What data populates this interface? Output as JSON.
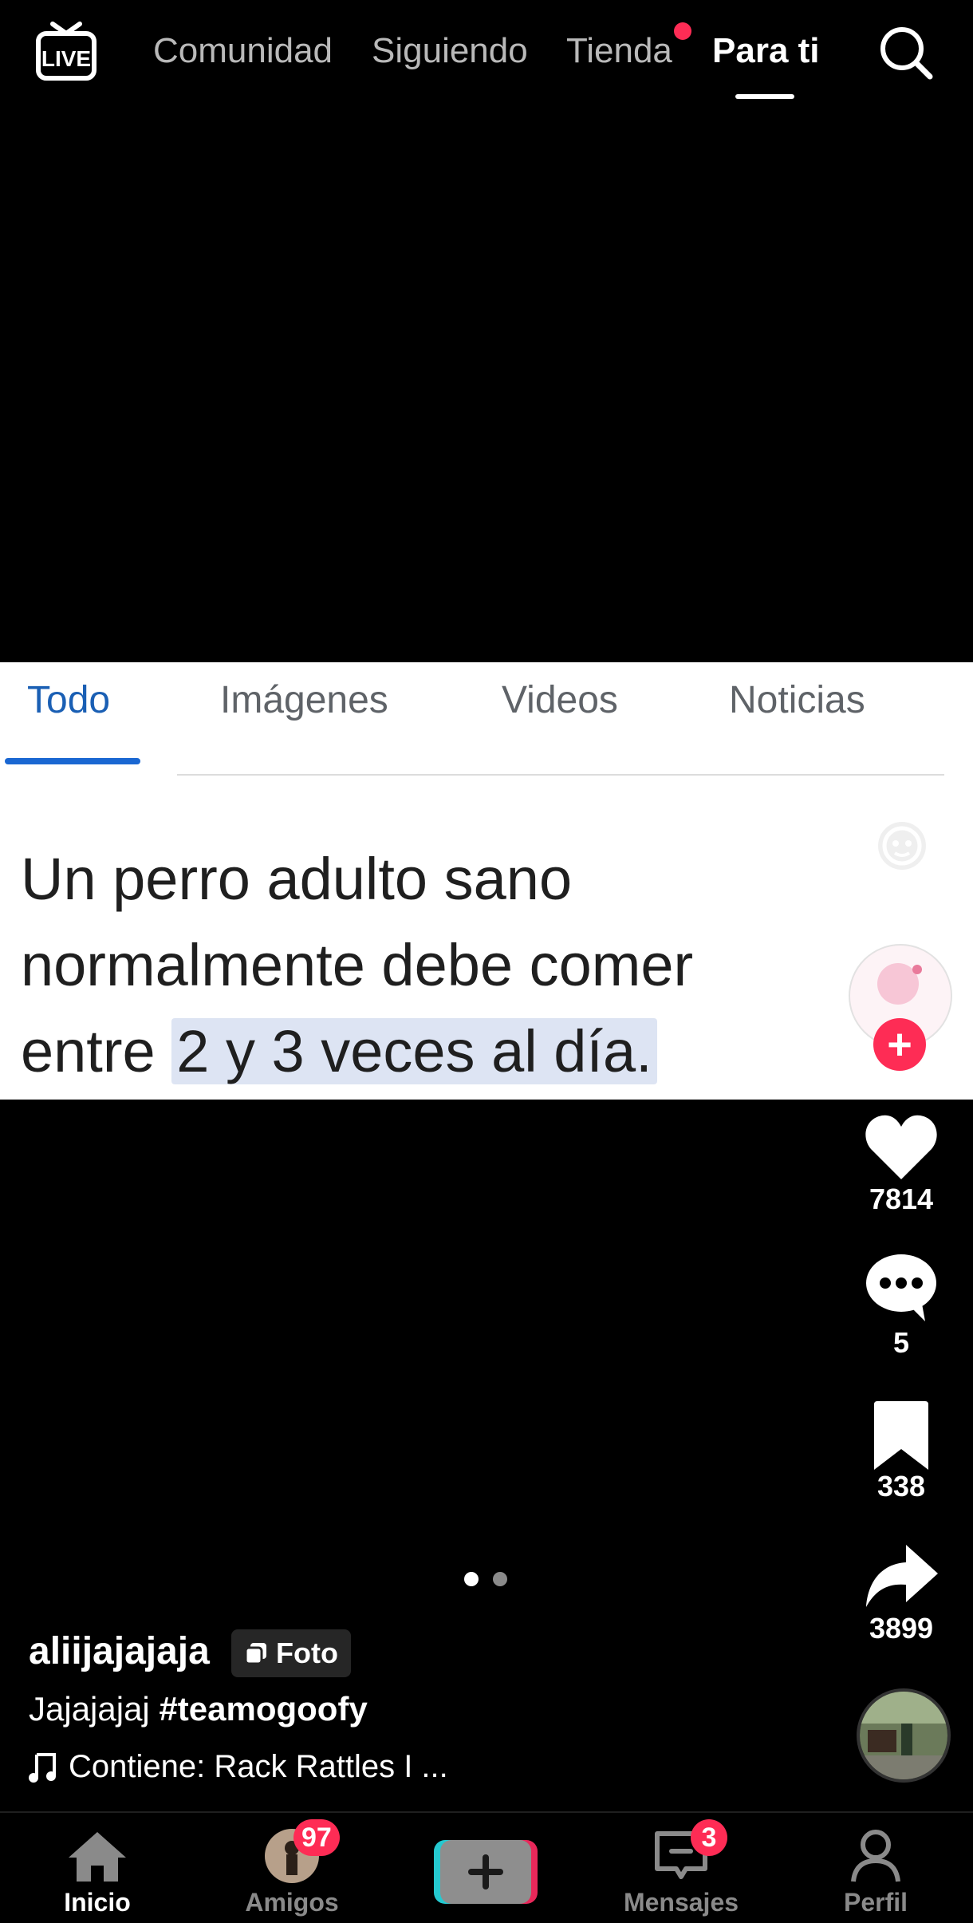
{
  "top_nav": {
    "live_label": "LIVE",
    "tabs": [
      "Comunidad",
      "Siguiendo",
      "Tienda",
      "Para ti"
    ],
    "active_tab": "Para ti"
  },
  "photo": {
    "search_tabs": [
      "Todo",
      "Imágenes",
      "Videos",
      "Noticias"
    ],
    "active_search_tab": "Todo",
    "answer_text": "Un perro adulto sano normalmente debe comer entre ",
    "answer_highlight": "2 y 3 veces al día.",
    "slide_count": 2,
    "current_slide": 1
  },
  "actions": {
    "likes": "7814",
    "comments": "5",
    "bookmarks": "338",
    "shares": "3899"
  },
  "post": {
    "username": "aliijajajaja",
    "badge_label": "Foto",
    "caption_text": "Jajajajaj",
    "hashtag": "#teamogoofy",
    "music_text": "Contiene: Rack Rattles I ..."
  },
  "bottom_nav": {
    "items": [
      {
        "label": "Inicio",
        "active": true
      },
      {
        "label": "Amigos",
        "badge": "97"
      },
      {
        "label": "",
        "type": "create"
      },
      {
        "label": "Mensajes",
        "badge": "3"
      },
      {
        "label": "Perfil"
      }
    ]
  },
  "colors": {
    "accent_red": "#fe2c55",
    "google_blue": "#1a67d2",
    "highlight_bg": "#dde4f3"
  }
}
